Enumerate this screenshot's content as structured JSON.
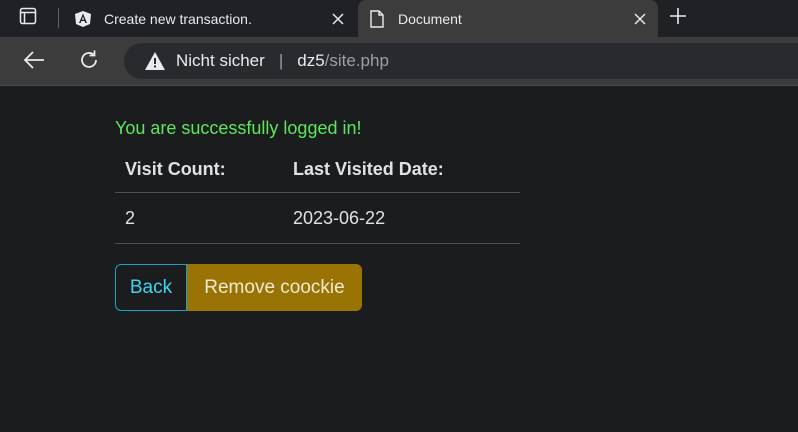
{
  "browser": {
    "tabs": [
      {
        "title": "Create new transaction.",
        "favicon": "angular-icon",
        "active": false
      },
      {
        "title": "Document",
        "favicon": "document-icon",
        "active": true
      }
    ],
    "address": {
      "security_label": "Nicht sicher",
      "separator": "|",
      "host": "dz5",
      "path": "/site.php"
    }
  },
  "page": {
    "message": "You are successfully logged in!",
    "table": {
      "headers": [
        "Visit Count:",
        "Last Visited Date:"
      ],
      "rows": [
        [
          "2",
          "2023-06-22"
        ]
      ]
    },
    "buttons": {
      "back_label": "Back",
      "remove_label": "Remove coockie"
    }
  },
  "colors": {
    "success_text": "#5ce65c",
    "info_outline": "#3dd5f3",
    "warning_bg": "#997404"
  }
}
